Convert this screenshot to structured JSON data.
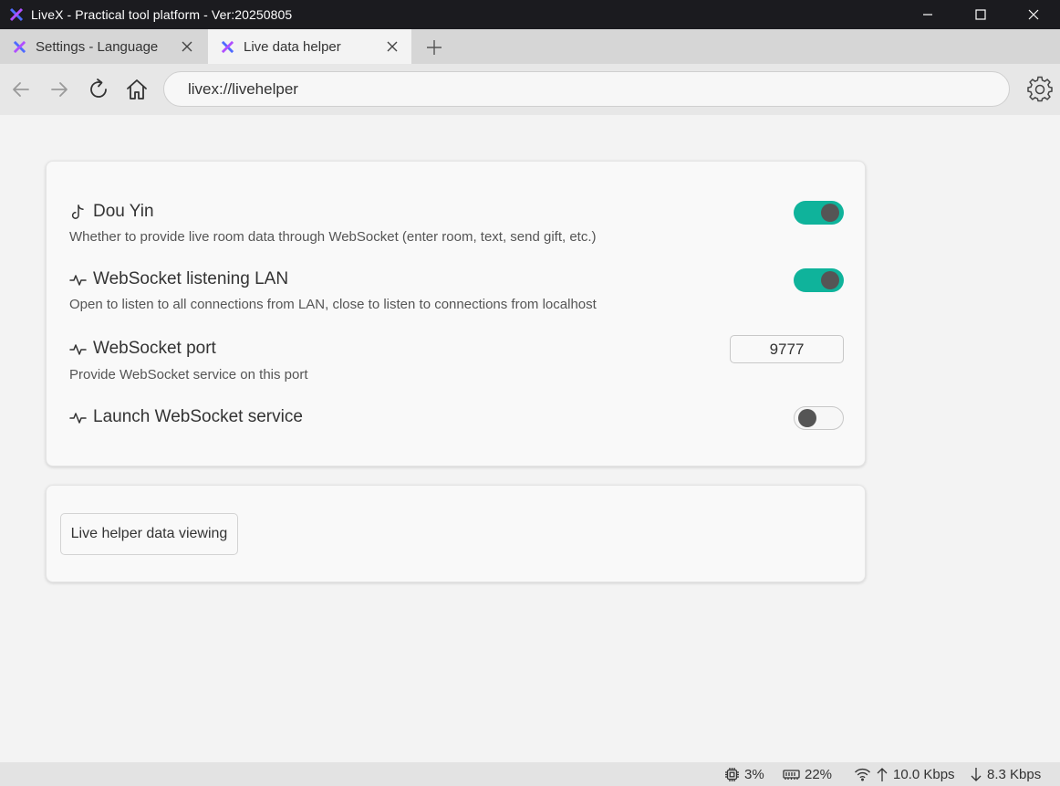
{
  "window": {
    "title": "LiveX - Practical tool platform - Ver:20250805",
    "logo_icon": "livex-logo-icon"
  },
  "tabs": [
    {
      "label": "Settings - Language",
      "active": false
    },
    {
      "label": "Live data helper",
      "active": true
    }
  ],
  "address": {
    "url": "livex://livehelper"
  },
  "settings": {
    "douyin": {
      "title": "Dou Yin",
      "description": "Whether to provide live room data through WebSocket (enter room, text, send gift, etc.)",
      "enabled": true
    },
    "lan": {
      "title": "WebSocket listening LAN",
      "description": "Open to listen to all connections from LAN, close to listen to connections from localhost",
      "enabled": true
    },
    "port": {
      "title": "WebSocket port",
      "description": "Provide WebSocket service on this port",
      "value": "9777"
    },
    "launch": {
      "title": "Launch WebSocket service",
      "enabled": false
    }
  },
  "viewer": {
    "button_label": "Live helper data viewing"
  },
  "status": {
    "cpu": "3%",
    "memory": "22%",
    "upload": "10.0 Kbps",
    "download": "8.3 Kbps"
  },
  "colors": {
    "accent": "#0fb39b",
    "titlebar": "#1b1b1f"
  }
}
